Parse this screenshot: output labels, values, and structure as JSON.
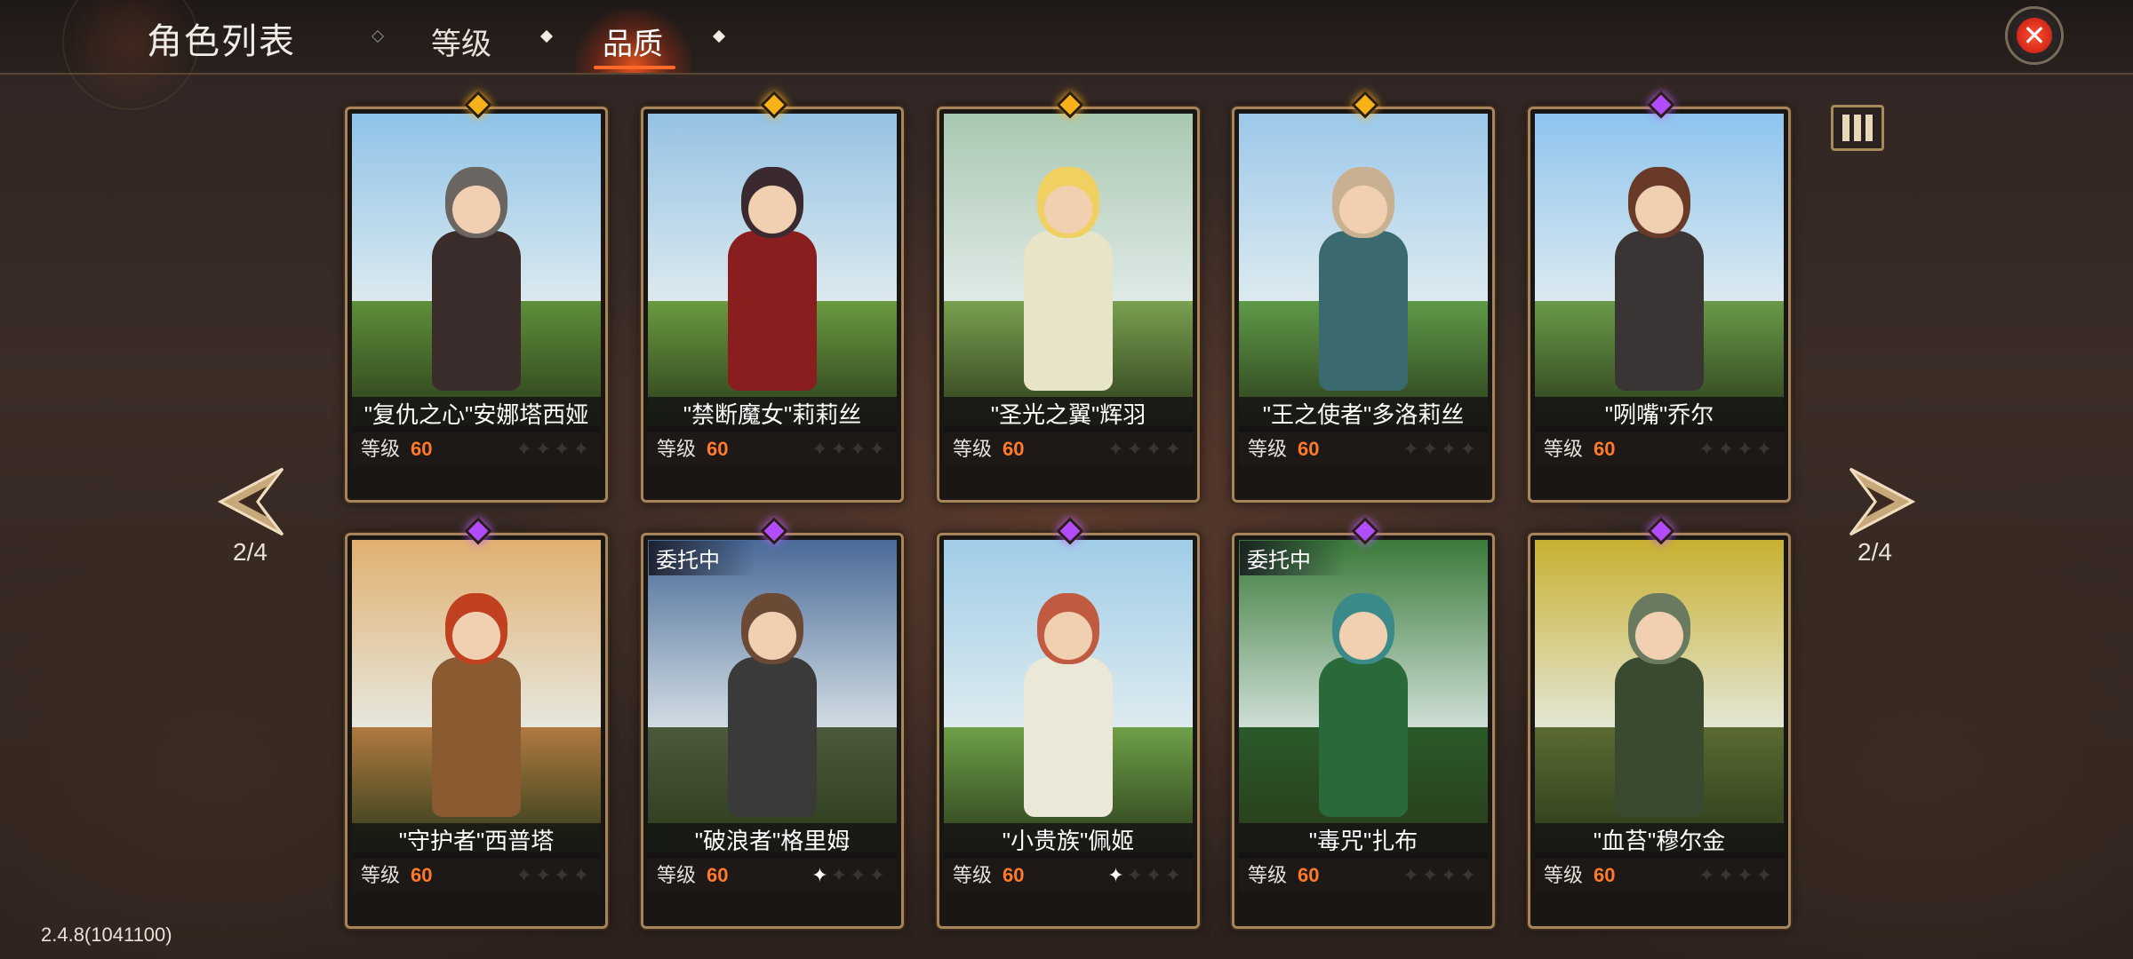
{
  "header": {
    "title": "角色列表",
    "tabs": [
      {
        "label": "等级",
        "active": false
      },
      {
        "label": "品质",
        "active": true
      }
    ]
  },
  "pager": {
    "left": "2/4",
    "right": "2/4"
  },
  "version": "2.4.8(1041100)",
  "level_label": "等级",
  "commission_label": "委托中",
  "colors": {
    "accent": "#ff6a2a",
    "gem_gold": "#f7b21a",
    "gem_purple": "#b34cff",
    "level_value": "#ff7a2a"
  },
  "cards": [
    {
      "name": "\"复仇之心\"安娜塔西娅",
      "level": "60",
      "gem": "gold",
      "stars_lit": 0,
      "commission": false,
      "sky": "#8fc3e8",
      "ground": "#5f8f3a",
      "hair": "#6a6560",
      "outfit": "#3a2c2a"
    },
    {
      "name": "\"禁断魔女\"莉莉丝",
      "level": "60",
      "gem": "gold",
      "stars_lit": 0,
      "commission": false,
      "sky": "#95c2e4",
      "ground": "#6a9a40",
      "hair": "#3a2a30",
      "outfit": "#8a1e1e"
    },
    {
      "name": "\"圣光之翼\"辉羽",
      "level": "60",
      "gem": "gold",
      "stars_lit": 0,
      "commission": false,
      "sky": "#a9c8b0",
      "ground": "#7aa050",
      "hair": "#f0d060",
      "outfit": "#e8e4c8"
    },
    {
      "name": "\"王之使者\"多洛莉丝",
      "level": "60",
      "gem": "gold",
      "stars_lit": 0,
      "commission": false,
      "sky": "#9cc8ea",
      "ground": "#5f9a48",
      "hair": "#c8b090",
      "outfit": "#3a6a70"
    },
    {
      "name": "\"咧嘴\"乔尔",
      "level": "60",
      "gem": "purple",
      "stars_lit": 0,
      "commission": false,
      "sky": "#8ec4ee",
      "ground": "#6a9a48",
      "hair": "#6a3a28",
      "outfit": "#3a3434"
    },
    {
      "name": "\"守护者\"西普塔",
      "level": "60",
      "gem": "purple",
      "stars_lit": 0,
      "commission": false,
      "sky": "#e0b070",
      "ground": "#b07a40",
      "hair": "#c04020",
      "outfit": "#8a5a30"
    },
    {
      "name": "\"破浪者\"格里姆",
      "level": "60",
      "gem": "purple",
      "stars_lit": 1,
      "commission": true,
      "sky": "#4a6a98",
      "ground": "#4a5a3a",
      "hair": "#6a4a34",
      "outfit": "#3a3a3a"
    },
    {
      "name": "\"小贵族\"佩姬",
      "level": "60",
      "gem": "purple",
      "stars_lit": 1,
      "commission": false,
      "sky": "#a0cde8",
      "ground": "#6ea048",
      "hair": "#c05a40",
      "outfit": "#ece8d8"
    },
    {
      "name": "\"毒咒\"扎布",
      "level": "60",
      "gem": "purple",
      "stars_lit": 0,
      "commission": true,
      "sky": "#3a7a3a",
      "ground": "#2a5a2a",
      "hair": "#3a8a8a",
      "outfit": "#2a6a3a"
    },
    {
      "name": "\"血苔\"穆尔金",
      "level": "60",
      "gem": "purple",
      "stars_lit": 0,
      "commission": false,
      "sky": "#c8b030",
      "ground": "#5a6a30",
      "hair": "#6a7a60",
      "outfit": "#3a4a30"
    }
  ]
}
